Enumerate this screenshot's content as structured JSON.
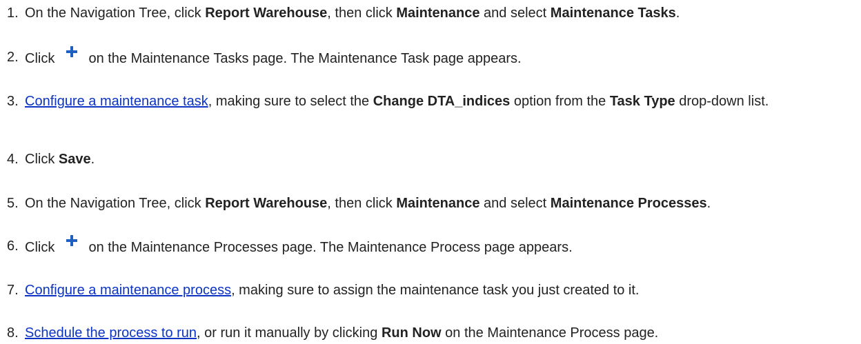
{
  "steps": [
    {
      "num": "1.",
      "parts": [
        {
          "t": "text",
          "v": "On the Navigation Tree, click "
        },
        {
          "t": "bold",
          "v": "Report Warehouse"
        },
        {
          "t": "text",
          "v": ", then click "
        },
        {
          "t": "bold",
          "v": "Maintenance"
        },
        {
          "t": "text",
          "v": " and select "
        },
        {
          "t": "bold",
          "v": "Maintenance Tasks"
        },
        {
          "t": "text",
          "v": "."
        }
      ]
    },
    {
      "num": "2.",
      "parts": [
        {
          "t": "text",
          "v": "Click "
        },
        {
          "t": "icon",
          "v": "plus-icon"
        },
        {
          "t": "text",
          "v": " on the Maintenance Tasks page. The Maintenance Task page appears."
        }
      ]
    },
    {
      "num": "3.",
      "parts": [
        {
          "t": "link",
          "v": "Configure a maintenance task"
        },
        {
          "t": "text",
          "v": ", making sure to select the "
        },
        {
          "t": "bold",
          "v": "Change DTA_indices"
        },
        {
          "t": "text",
          "v": " option from the "
        },
        {
          "t": "bold",
          "v": "Task Type"
        },
        {
          "t": "text",
          "v": " drop-down list."
        }
      ]
    },
    {
      "num": "4.",
      "parts": [
        {
          "t": "text",
          "v": "Click "
        },
        {
          "t": "bold",
          "v": "Save"
        },
        {
          "t": "text",
          "v": "."
        }
      ]
    },
    {
      "num": "5.",
      "parts": [
        {
          "t": "text",
          "v": "On the Navigation Tree, click "
        },
        {
          "t": "bold",
          "v": "Report Warehouse"
        },
        {
          "t": "text",
          "v": ", then click "
        },
        {
          "t": "bold",
          "v": "Maintenance"
        },
        {
          "t": "text",
          "v": " and select "
        },
        {
          "t": "bold",
          "v": "Maintenance Processes"
        },
        {
          "t": "text",
          "v": "."
        }
      ]
    },
    {
      "num": "6.",
      "parts": [
        {
          "t": "text",
          "v": "Click "
        },
        {
          "t": "icon",
          "v": "plus-icon"
        },
        {
          "t": "text",
          "v": " on the Maintenance Processes page. The Maintenance Process page appears."
        }
      ]
    },
    {
      "num": "7.",
      "parts": [
        {
          "t": "link",
          "v": "Configure a maintenance process"
        },
        {
          "t": "text",
          "v": ", making sure to assign the maintenance task you just created to it."
        }
      ]
    },
    {
      "num": "8.",
      "parts": [
        {
          "t": "link",
          "v": "Schedule the process to run"
        },
        {
          "t": "text",
          "v": ", or run it manually by clicking "
        },
        {
          "t": "bold",
          "v": "Run Now"
        },
        {
          "t": "text",
          "v": " on the Maintenance Process page."
        }
      ]
    }
  ],
  "colors": {
    "text": "#222222",
    "link": "#0b34c4",
    "plus_icon": "#1f5fbf"
  }
}
